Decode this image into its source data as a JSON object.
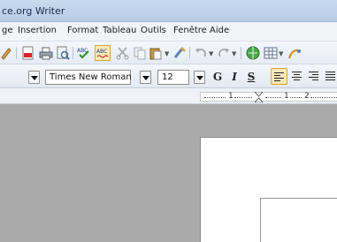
{
  "window": {
    "title": "ce.org Writer"
  },
  "menu": {
    "items": [
      {
        "label": "ge"
      },
      {
        "label": "Insertion"
      },
      {
        "label": "Format"
      },
      {
        "label": "Tableau"
      },
      {
        "label": "Outils"
      },
      {
        "label": "Fenêtre"
      },
      {
        "label": "Aide"
      }
    ]
  },
  "format_toolbar": {
    "font_name": "Times New Roman",
    "font_size": "12",
    "bold": "G",
    "italic": "I",
    "underline": "S"
  },
  "ruler": {
    "labels": [
      "1",
      "1",
      "2"
    ]
  },
  "colors": {
    "accent_active": "#fbe9b6",
    "workspace": "#ababab"
  }
}
